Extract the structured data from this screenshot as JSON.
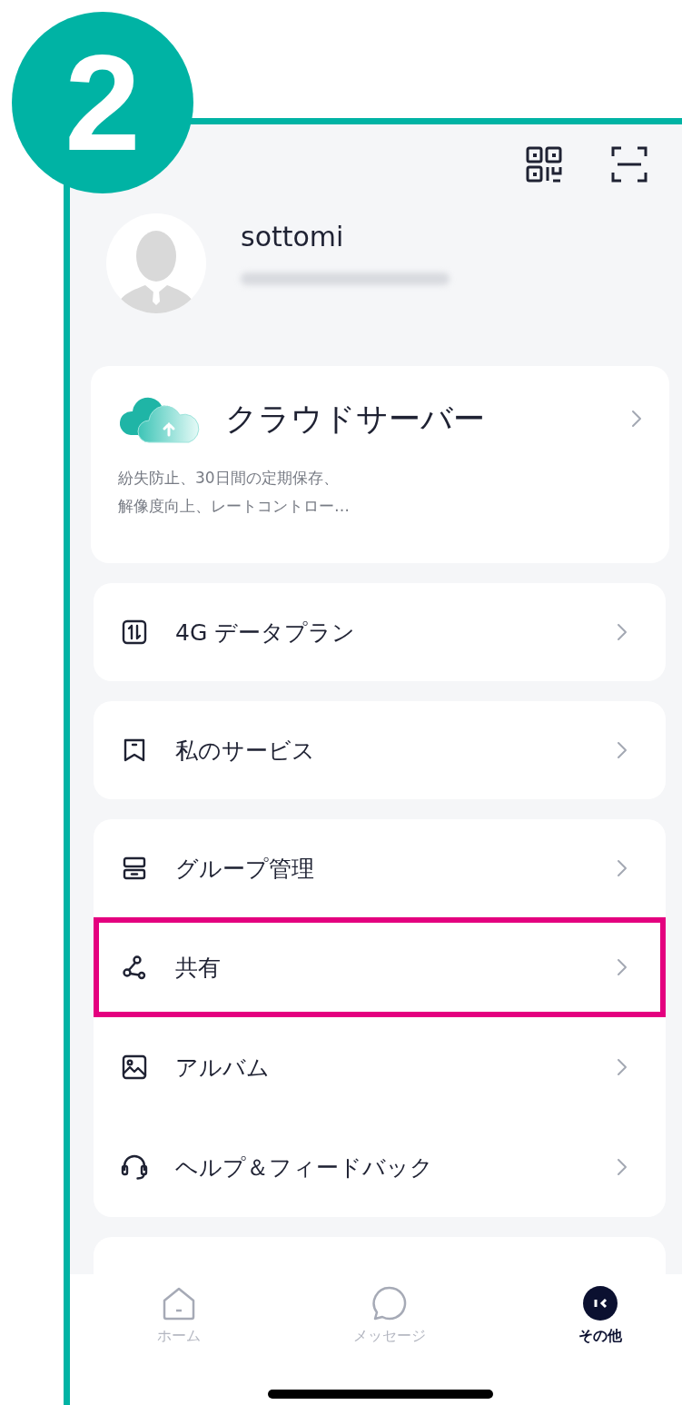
{
  "step_badge": "2",
  "profile": {
    "name": "sottomi"
  },
  "cloud_card": {
    "title": "クラウドサーバー",
    "description_lines": [
      "紛失防止、30日間の定期保存、",
      "解像度向上、レートコントロー…"
    ]
  },
  "cards": [
    {
      "rows": [
        {
          "label": "4G データプラン",
          "highlighted": false
        }
      ]
    },
    {
      "rows": [
        {
          "label": "私のサービス",
          "highlighted": false
        }
      ]
    },
    {
      "rows": [
        {
          "label": "グループ管理",
          "highlighted": false
        },
        {
          "label": "共有",
          "highlighted": true
        },
        {
          "label": "アルバム",
          "highlighted": false
        },
        {
          "label": "ヘルプ＆フィードバック",
          "highlighted": false
        }
      ]
    }
  ],
  "tab_bar": [
    {
      "label": "ホーム",
      "selected": false
    },
    {
      "label": "メッセージ",
      "selected": false
    },
    {
      "label": "その他",
      "selected": true
    }
  ]
}
